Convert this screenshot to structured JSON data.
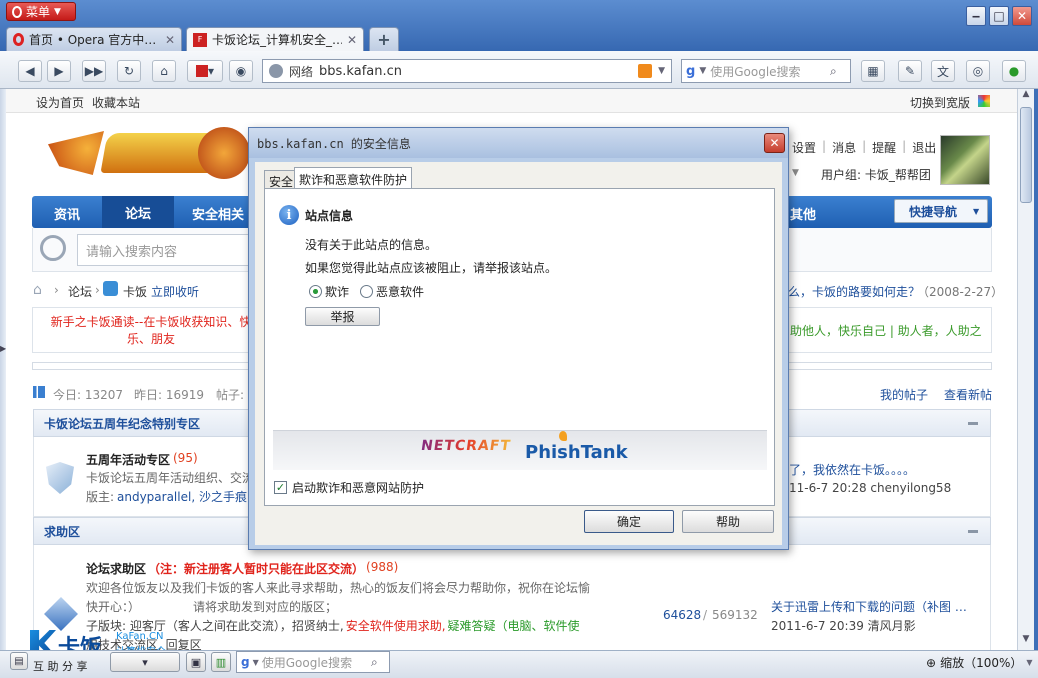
{
  "window": {
    "menu_label": "菜单",
    "tabs": [
      {
        "label": "首页 • Opera 官方中…"
      },
      {
        "label": "卡饭论坛_计算机安全_…"
      }
    ],
    "new_tab": "+"
  },
  "toolbar": {
    "zone_label": "网络",
    "address": "bbs.kafan.cn",
    "search_placeholder": "使用Google搜索"
  },
  "page": {
    "top_links": [
      "设为首页",
      "收藏本站"
    ],
    "switch_view": "切换到宽版",
    "user_links": [
      "设置",
      "消息",
      "提醒",
      "退出"
    ],
    "user_group": "用户组: 卡饭_帮帮团",
    "nav": [
      "资讯",
      "论坛",
      "安全相关",
      "其他"
    ],
    "quick_nav": "快捷导航",
    "search_placeholder": "请输入搜索内容",
    "breadcrumb": [
      "论坛",
      "卡饭",
      "立即收听"
    ],
    "announce_left": "新手之卡饭通读--在卡饭收获知识、快乐、朋友",
    "announce_right_title": "么，卡饭的路要如何走？",
    "announce_right_date": "（2008-2-27）",
    "announce_right2": "助他人，快乐自己 | 助人者，人助之",
    "stats": {
      "today": "今日: 13207",
      "yesterday": "昨日: 16919",
      "posts": "帖子:"
    },
    "my_posts": "我的帖子",
    "view_new": "查看新帖",
    "section1": {
      "title": "卡饭论坛五周年纪念特别专区",
      "forum_name": "五周年活动专区",
      "forum_count": "(95)",
      "forum_desc": "卡饭论坛五周年活动组织、交流",
      "moderators_label": "版主:",
      "moderators": "andyparallel, 沙之手痕, 刹",
      "last_title": "了，我依然在卡饭。。。。",
      "last_time": "11-6-7 20:28 chenyilong58"
    },
    "section2": {
      "title": "求助区",
      "forum_name": "论坛求助区",
      "forum_note": "（注：新注册客人暂时只能在此区交流）",
      "forum_count": "(988)",
      "desc1": "欢迎各位饭友以及我们卡饭的客人来此寻求帮助，热心的饭友们将会尽力帮助你，祝你在论坛愉",
      "desc2": "快开心：）",
      "desc3": "请将求助发到对应的版区；",
      "sub_label": "子版块: 迎客厅（客人之间在此交流），招贤纳士,",
      "sub_red": "安全软件使用求助,",
      "sub_green": "疑难答疑（电脑、软件使",
      "sub_line2": "用技术交流区, 回复区",
      "threads": "64628",
      "posts": "569132",
      "last_title": "关于迅雷上传和下载的问题（补图 …",
      "last_time": "2011-6-7 20:39 清风月影"
    }
  },
  "dialog": {
    "title": "bbs.kafan.cn 的安全信息",
    "tabs": [
      "安全",
      "欺诈和恶意软件防护"
    ],
    "heading": "站点信息",
    "line1": "没有关于此站点的信息。",
    "line2": "如果您觉得此站点应该被阻止，请举报该站点。",
    "radio_fraud": "欺诈",
    "radio_malware": "恶意软件",
    "report": "举报",
    "logo1": "NETCRAFT",
    "logo2": "PhishTank",
    "checkbox_label": "启动欺诈和恶意网站防护",
    "ok": "确定",
    "help": "帮助"
  },
  "status": {
    "left": "互 助 分 享",
    "search_placeholder": "使用Google搜索",
    "zoom": "缩放（100%）",
    "watermark_brand": "卡饭",
    "watermark_url": "KaFan.CN",
    "watermark_sub": "计算机安全"
  },
  "colors": {
    "accent": "#1e5fb4",
    "chrome": "#3d6fb8",
    "nav": "#2a6cc0"
  }
}
